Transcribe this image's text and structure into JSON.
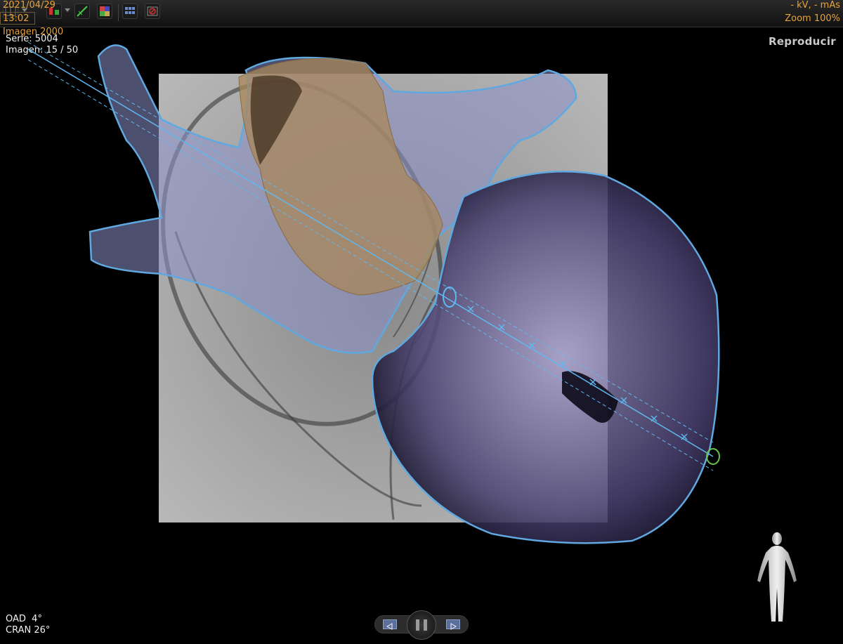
{
  "toolbar": {
    "icons": [
      "layout-grid-icon",
      "calibration-icon",
      "measure-icon",
      "color-map-icon",
      "series-browser-icon",
      "video-record-icon"
    ]
  },
  "header": {
    "date": "2021/04/29",
    "time": "13:02",
    "image_label": "Imagen 2000",
    "series": "Serie: 5004",
    "image_index": "Imagen: 15 / 50",
    "exposure": "- kV, - mAs",
    "zoom": "Zoom 100%"
  },
  "play_label": "Reproducir",
  "angles": {
    "oad": "OAD  4°",
    "cran": "CRAN 26°"
  },
  "player": {
    "prev_icon": "step-back-icon",
    "pause_icon": "pause-icon",
    "next_icon": "step-forward-icon"
  },
  "colors": {
    "accent_orange": "#e8a33a",
    "outline_blue": "#5fa8e0",
    "ventricle_purple": "#8f86b8",
    "atrium_tan": "#a8875a"
  }
}
